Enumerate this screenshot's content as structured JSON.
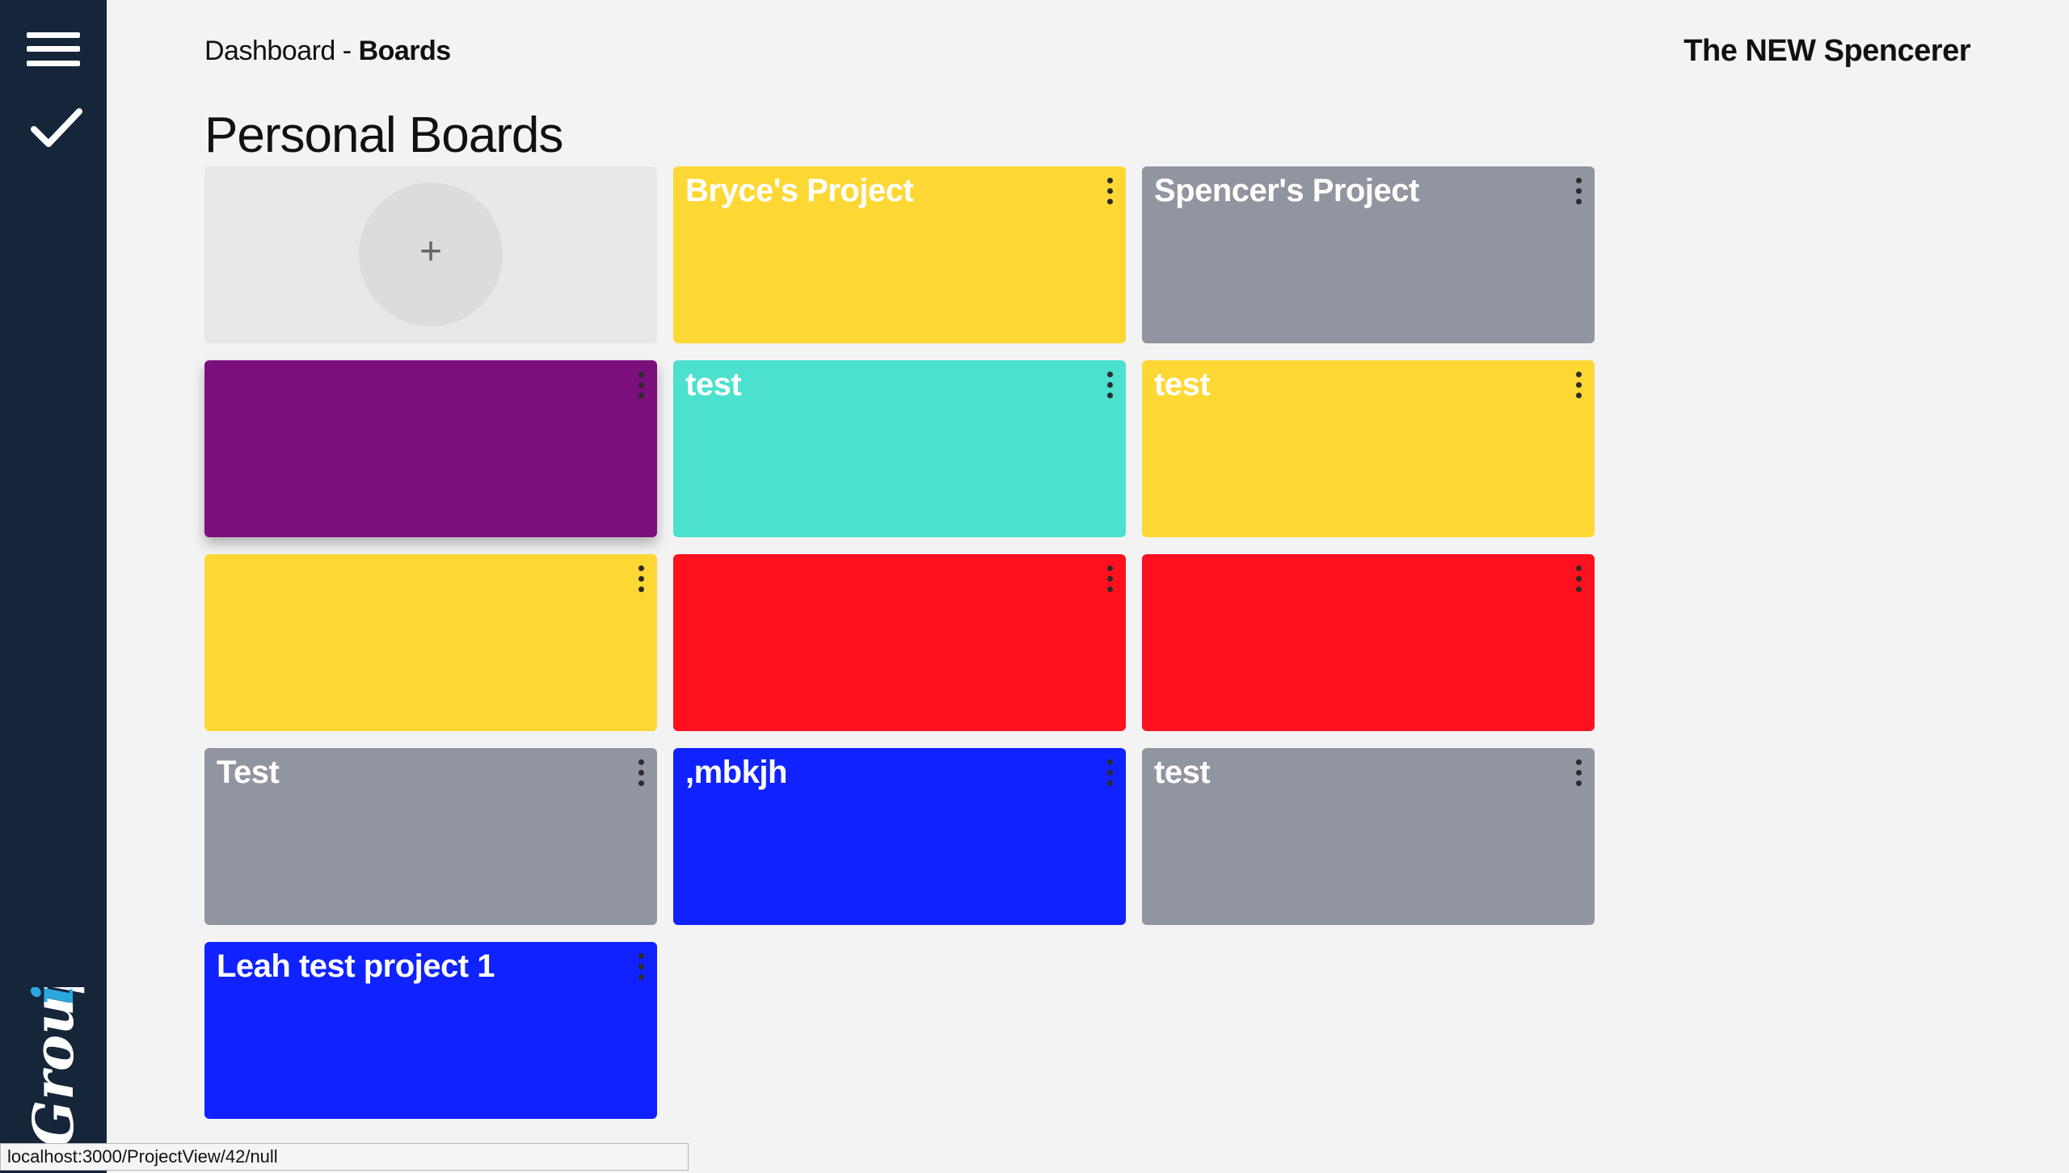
{
  "sidebar": {
    "brand": "Groupii",
    "brand_colors": {
      "main": "#ffffff",
      "accent": "#29a8e0"
    }
  },
  "header": {
    "breadcrumb_link": "Dashboard",
    "breadcrumb_sep": " - ",
    "breadcrumb_current": "Boards",
    "user_name": "The NEW Spencerer"
  },
  "section": {
    "title": "Personal Boards"
  },
  "add_board": {
    "icon": "+"
  },
  "boards": [
    {
      "title": "Bryce's Project",
      "color": "#fdd835"
    },
    {
      "title": "Spencer's Project",
      "color": "#9195a0"
    },
    {
      "title": "",
      "color": "#7b0f7b"
    },
    {
      "title": "test",
      "color": "#4ce0cf"
    },
    {
      "title": "test",
      "color": "#fdd835"
    },
    {
      "title": "",
      "color": "#fdd835"
    },
    {
      "title": "",
      "color": "#ff101f"
    },
    {
      "title": "",
      "color": "#ff101f"
    },
    {
      "title": "Test",
      "color": "#9195a0"
    },
    {
      "title": ",mbkjh",
      "color": "#0f22ff"
    },
    {
      "title": "test",
      "color": "#9195a0"
    },
    {
      "title": "Leah test project 1",
      "color": "#0f22ff"
    }
  ],
  "status_bar": {
    "url": "localhost:3000/ProjectView/42/null"
  }
}
